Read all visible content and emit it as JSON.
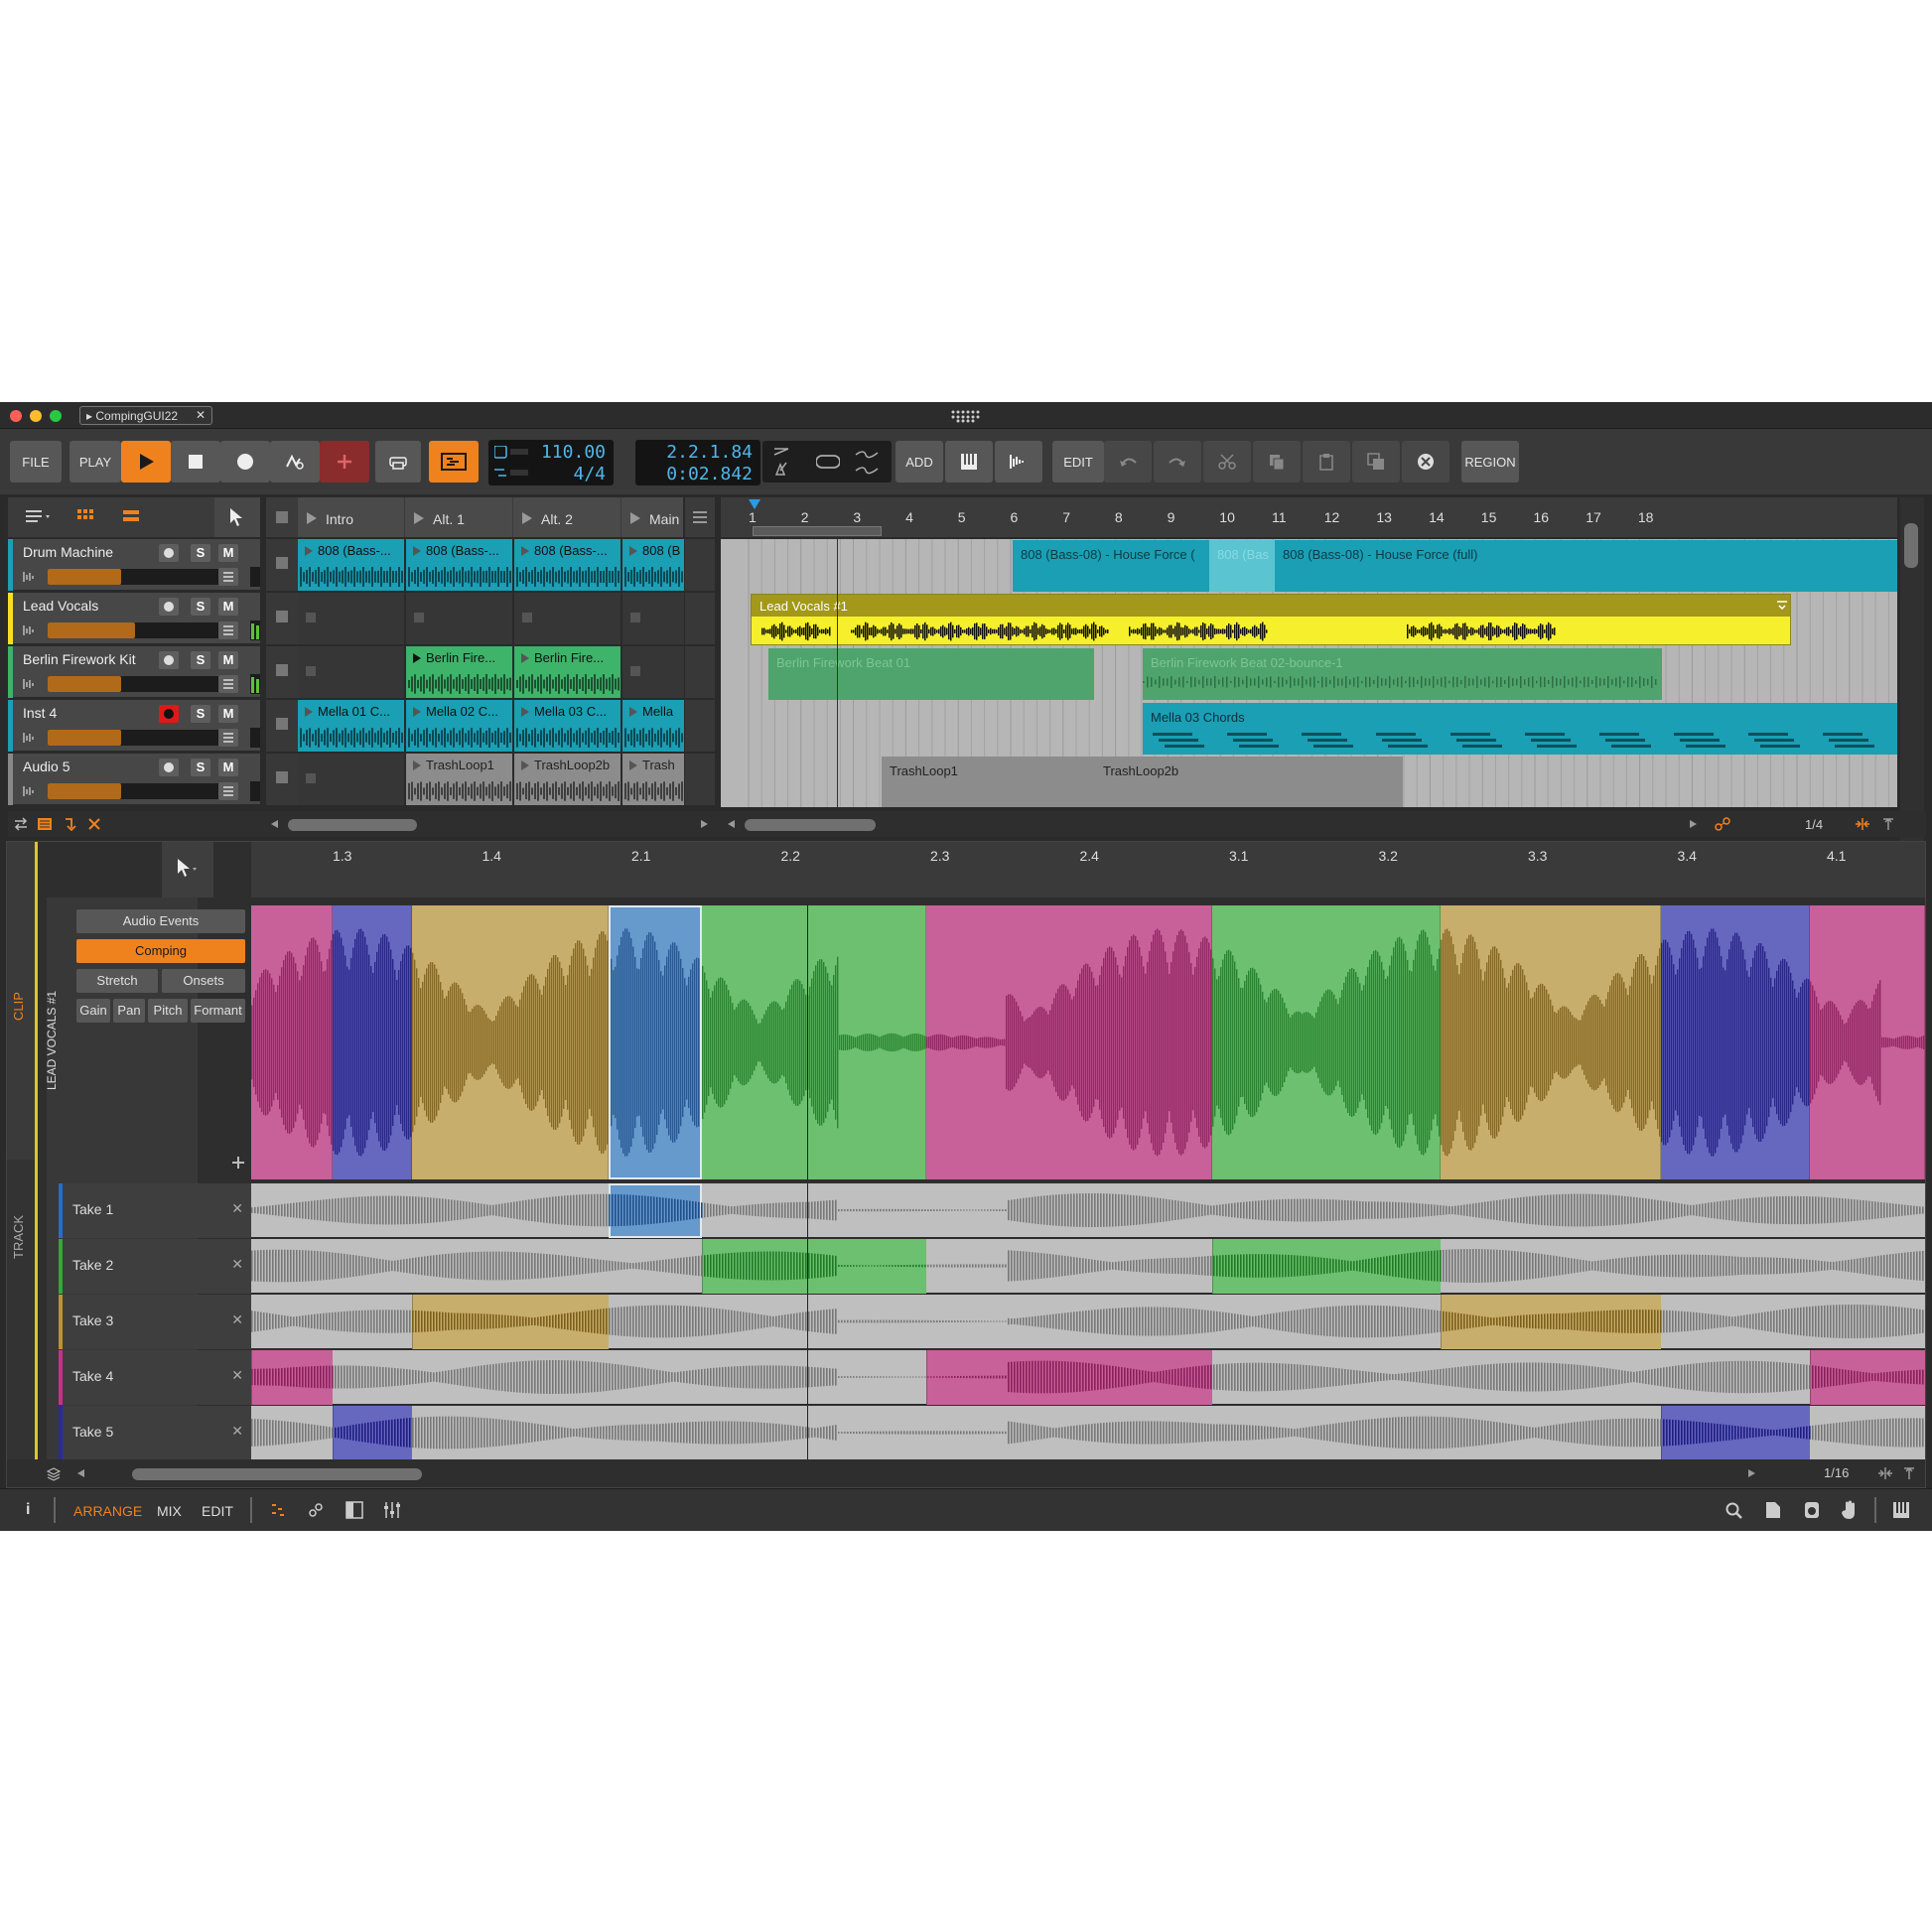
{
  "window": {
    "tab_title": "CompingGUI22"
  },
  "toolbar": {
    "file": "FILE",
    "play": "PLAY",
    "add": "ADD",
    "edit": "EDIT",
    "region": "REGION",
    "tempo": "110.00",
    "signature": "4/4",
    "position_bars": "2.2.1.84",
    "position_time": "0:02.842"
  },
  "scenes": {
    "items": [
      "Intro",
      "Alt. 1",
      "Alt. 2",
      "Main"
    ]
  },
  "tracks": [
    {
      "name": "Drum Machine",
      "color": "#1a9fb5",
      "rec": false,
      "fader": 0.42
    },
    {
      "name": "Lead Vocals",
      "color": "#f5e020",
      "rec": false,
      "fader": 0.5
    },
    {
      "name": "Berlin Firework Kit",
      "color": "#3eb36a",
      "rec": false,
      "fader": 0.42
    },
    {
      "name": "Inst 4",
      "color": "#1a9fb5",
      "rec": true,
      "fader": 0.42
    },
    {
      "name": "Audio 5",
      "color": "#888888",
      "rec": false,
      "fader": 0.42
    }
  ],
  "clip_launcher": {
    "rows": [
      [
        "808 (Bass-...",
        "808 (Bass-...",
        "808 (Bass-...",
        "808 (B"
      ],
      [
        "",
        "",
        "",
        ""
      ],
      [
        "",
        "Berlin Fire...",
        "Berlin Fire...",
        ""
      ],
      [
        "Mella 01 C...",
        "Mella 02 C...",
        "Mella 03 C...",
        "Mella"
      ],
      [
        "",
        "TrashLoop1",
        "TrashLoop2b",
        "Trash"
      ]
    ]
  },
  "arranger": {
    "ruler": [
      "1",
      "2",
      "3",
      "4",
      "5",
      "6",
      "7",
      "8",
      "9",
      "10",
      "11",
      "12",
      "13",
      "14",
      "15",
      "16",
      "17",
      "18"
    ],
    "clips": {
      "drum_a": "808 (Bass-08) - House Force (",
      "drum_b": "808 (Bas",
      "drum_c": "808 (Bass-08) - House Force (full)",
      "vocals": "Lead Vocals #1",
      "berlin_a": "Berlin Firework Beat 01",
      "berlin_b": "Berlin Firework Beat 02-bounce-1",
      "mella": "Mella 03 Chords",
      "trash_a": "TrashLoop1",
      "trash_b": "TrashLoop2b"
    },
    "grid": "1/4"
  },
  "editor": {
    "side_clip": "CLIP",
    "side_track": "TRACK",
    "clip_name": "LEAD VOCALS #1",
    "ruler": [
      "1.3",
      "1.4",
      "2.1",
      "2.2",
      "2.3",
      "2.4",
      "3.1",
      "3.2",
      "3.3",
      "3.4",
      "4.1"
    ],
    "modes": {
      "audio_events": "Audio Events",
      "comping": "Comping",
      "stretch": "Stretch",
      "onsets": "Onsets",
      "gain": "Gain",
      "pan": "Pan",
      "pitch": "Pitch",
      "formant": "Formant"
    },
    "takes": [
      "Take 1",
      "Take 2",
      "Take 3",
      "Take 4",
      "Take 5"
    ],
    "grid": "1/16"
  },
  "statusbar": {
    "arrange": "ARRANGE",
    "mix": "MIX",
    "edit": "EDIT"
  },
  "colors": {
    "accent": "#f0821e",
    "pink": "#c8609a",
    "purple": "#6668c0",
    "tan": "#c8ae6c",
    "blue": "#6699cc",
    "green": "#6cc070"
  }
}
